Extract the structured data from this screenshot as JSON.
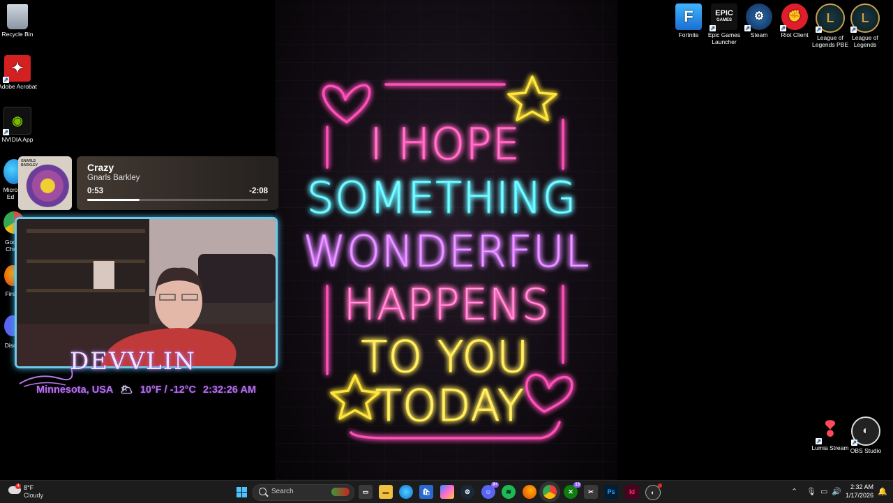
{
  "wallpaper": {
    "lines": [
      "I HOPE",
      "SOMETHING",
      "WONDERFUL",
      "HAPPENS",
      "TO YOU",
      "TODAY"
    ],
    "colors": {
      "pink": "#ff4fb8",
      "cyan": "#3ff0ff",
      "violet": "#d66cff",
      "yellow": "#ffe43a"
    }
  },
  "desktop_left": [
    {
      "label": "Recycle Bin",
      "icon": "recycle-bin-icon"
    },
    {
      "label": "Adobe Acrobat",
      "icon": "adobe-acrobat-icon"
    },
    {
      "label": "NVIDIA App",
      "icon": "nvidia-icon"
    }
  ],
  "desktop_left_partial": [
    "Micro Ed",
    "Goo Chr",
    "Fire",
    "Disc"
  ],
  "desktop_right": [
    {
      "label": "Fortnite",
      "icon": "fortnite-icon"
    },
    {
      "label": "Epic Games Launcher",
      "icon": "epic-games-icon"
    },
    {
      "label": "Steam",
      "icon": "steam-icon"
    },
    {
      "label": "Riot Client",
      "icon": "riot-client-icon"
    },
    {
      "label": "League of Legends PBE",
      "icon": "league-pbe-icon"
    },
    {
      "label": "League of Legends",
      "icon": "league-icon"
    }
  ],
  "desktop_bottom_right": [
    {
      "label": "Lumia Stream",
      "icon": "lumia-stream-icon"
    },
    {
      "label": "OBS Studio",
      "icon": "obs-studio-icon"
    }
  ],
  "media": {
    "title": "Crazy",
    "artist": "Gnarls Barkley",
    "elapsed": "0:53",
    "remaining": "-2:08",
    "progress": 0.29,
    "album_art_text": "GNARLS BARKLEY"
  },
  "webcam": {
    "name": "DEVVLIN",
    "location": "Minnesota, USA",
    "weather_icon": "partly-cloudy-icon",
    "temperature": "10°F / -12°C",
    "time": "2:32:26 AM"
  },
  "taskbar": {
    "weather": {
      "temp": "8°F",
      "condition": "Cloudy",
      "alert_count": "4"
    },
    "search_placeholder": "Search",
    "apps": [
      "task-view",
      "file-explorer",
      "edge",
      "microsoft-store",
      "copilot",
      "steam",
      "discord",
      "spotify",
      "firefox",
      "chrome",
      "xbox",
      "snipping-tool",
      "photoshop",
      "indesign",
      "obs"
    ],
    "discord_badge": "9+",
    "xbox_badge": "13",
    "clock": {
      "time": "2:32 AM",
      "date": "1/17/2026"
    }
  }
}
